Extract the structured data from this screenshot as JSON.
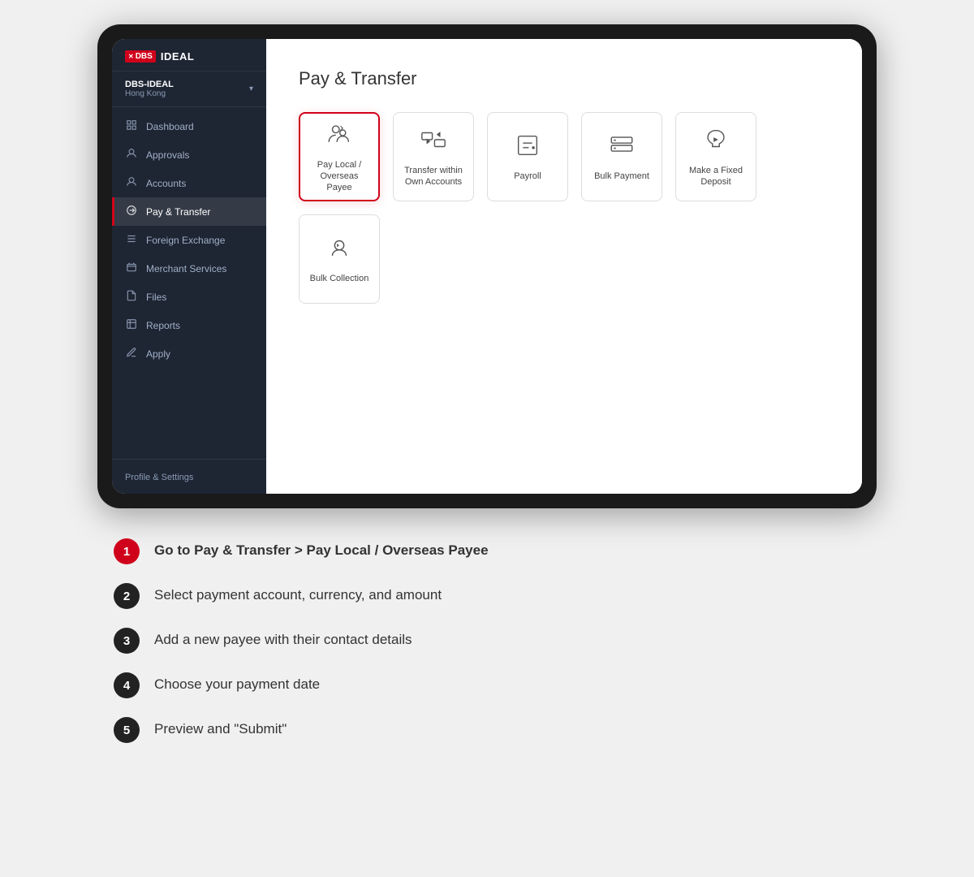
{
  "app": {
    "logo_x": "×",
    "logo_dbs": "DBS",
    "logo_ideal": "IDEAL"
  },
  "sidebar": {
    "account_name": "DBS-IDEAL",
    "account_region": "Hong Kong",
    "nav_items": [
      {
        "id": "dashboard",
        "label": "Dashboard",
        "icon": "⌂"
      },
      {
        "id": "approvals",
        "label": "Approvals",
        "icon": "✓"
      },
      {
        "id": "accounts",
        "label": "Accounts",
        "icon": "👤"
      },
      {
        "id": "pay-transfer",
        "label": "Pay & Transfer",
        "icon": "⟳",
        "active": true
      },
      {
        "id": "foreign-exchange",
        "label": "Foreign Exchange",
        "icon": "💱"
      },
      {
        "id": "merchant-services",
        "label": "Merchant Services",
        "icon": "🏪"
      },
      {
        "id": "files",
        "label": "Files",
        "icon": "📄"
      },
      {
        "id": "reports",
        "label": "Reports",
        "icon": "📊"
      },
      {
        "id": "apply",
        "label": "Apply",
        "icon": "✎"
      }
    ],
    "footer_label": "Profile & Settings"
  },
  "main": {
    "page_title": "Pay & Transfer",
    "service_cards": [
      {
        "id": "pay-local",
        "label": "Pay Local /\nOverseas Payee",
        "selected": true
      },
      {
        "id": "transfer-own",
        "label": "Transfer within Own Accounts",
        "selected": false
      },
      {
        "id": "payroll",
        "label": "Payroll",
        "selected": false
      },
      {
        "id": "bulk-payment",
        "label": "Bulk Payment",
        "selected": false
      },
      {
        "id": "fixed-deposit",
        "label": "Make a Fixed Deposit",
        "selected": false
      },
      {
        "id": "bulk-collection",
        "label": "Bulk Collection",
        "selected": false
      }
    ]
  },
  "instructions": [
    {
      "step": 1,
      "style": "red",
      "text": "Go to Pay & Transfer > Pay Local / Overseas Payee",
      "bold": true
    },
    {
      "step": 2,
      "style": "dark",
      "text": "Select payment account, currency, and amount",
      "bold": false
    },
    {
      "step": 3,
      "style": "dark",
      "text": "Add a new payee with their contact details",
      "bold": false
    },
    {
      "step": 4,
      "style": "dark",
      "text": "Choose your payment date",
      "bold": false
    },
    {
      "step": 5,
      "style": "dark",
      "text": "Preview and \"Submit\"",
      "bold": false
    }
  ]
}
